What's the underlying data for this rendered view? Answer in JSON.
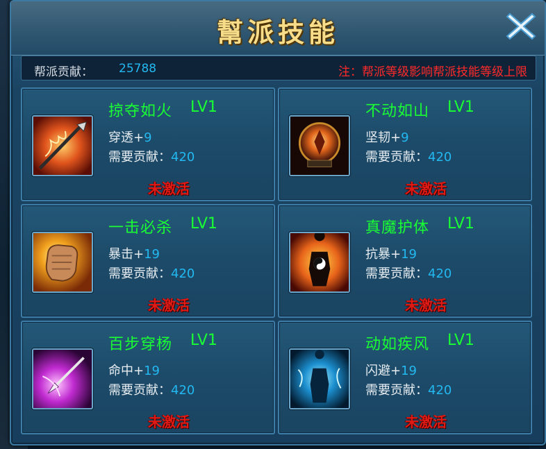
{
  "window": {
    "title": "幫派技能",
    "close_icon": "close-x-icon"
  },
  "contribution": {
    "label": "帮派贡献：",
    "value": "25788",
    "note": "注：帮派等级影响帮派技能等级上限"
  },
  "skills": [
    {
      "name": "掠夺如火",
      "level": "LV1",
      "stat_name": "穿透",
      "stat_plus": "+",
      "stat_value": "9",
      "cost_label": "需要贡献：",
      "cost_value": "420",
      "status": "未激活",
      "icon": "flaming-spear-icon"
    },
    {
      "name": "不动如山",
      "level": "LV1",
      "stat_name": "坚韧",
      "stat_plus": "+",
      "stat_value": "9",
      "cost_label": "需要贡献：",
      "cost_value": "420",
      "status": "未激活",
      "icon": "fire-shield-icon"
    },
    {
      "name": "一击必杀",
      "level": "LV1",
      "stat_name": "暴击",
      "stat_plus": "+",
      "stat_value": "19",
      "cost_label": "需要贡献：",
      "cost_value": "420",
      "status": "未激活",
      "icon": "flaming-fist-icon"
    },
    {
      "name": "真魔护体",
      "level": "LV1",
      "stat_name": "抗暴",
      "stat_plus": "+",
      "stat_value": "19",
      "cost_label": "需要贡献：",
      "cost_value": "420",
      "status": "未激活",
      "icon": "yinyang-flame-body-icon"
    },
    {
      "name": "百步穿杨",
      "level": "LV1",
      "stat_name": "命中",
      "stat_plus": "+",
      "stat_value": "19",
      "cost_label": "需要贡献：",
      "cost_value": "420",
      "status": "未激活",
      "icon": "magic-arrow-icon"
    },
    {
      "name": "动如疾风",
      "level": "LV1",
      "stat_name": "闪避",
      "stat_plus": "+",
      "stat_value": "19",
      "cost_label": "需要贡献：",
      "cost_value": "420",
      "status": "未激活",
      "icon": "wind-silhouette-icon"
    }
  ],
  "colors": {
    "skill_name": "#19ff33",
    "value_blue": "#23b8f0",
    "status_red": "#e01a14",
    "note_red": "#ff2a2a",
    "title_gold": "#f7dd8a"
  }
}
